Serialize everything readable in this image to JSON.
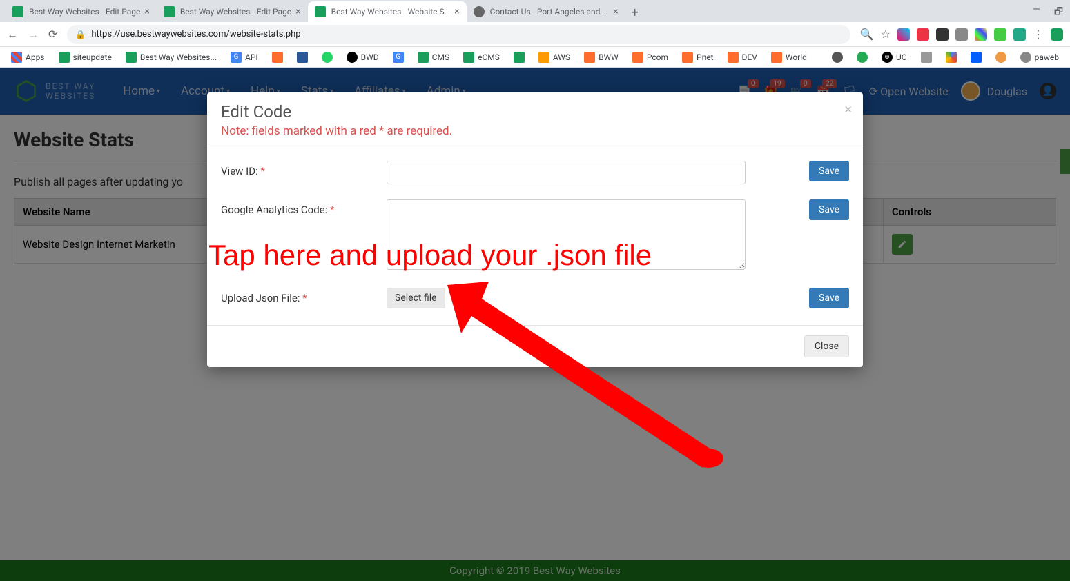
{
  "browser": {
    "tabs": [
      {
        "title": "Best Way Websites - Edit Page",
        "active": false
      },
      {
        "title": "Best Way Websites - Edit Page",
        "active": false
      },
      {
        "title": "Best Way Websites - Website Stat",
        "active": true
      },
      {
        "title": "Contact Us - Port Angeles and Se",
        "active": false
      }
    ],
    "url": "https://use.bestwaywebsites.com/website-stats.php",
    "bookmarks": [
      {
        "label": "Apps"
      },
      {
        "label": "siteupdate"
      },
      {
        "label": "Best Way Websites..."
      },
      {
        "label": "API"
      },
      {
        "label": ""
      },
      {
        "label": ""
      },
      {
        "label": ""
      },
      {
        "label": "BWD"
      },
      {
        "label": ""
      },
      {
        "label": "CMS"
      },
      {
        "label": "eCMS"
      },
      {
        "label": ""
      },
      {
        "label": "AWS"
      },
      {
        "label": "BWW"
      },
      {
        "label": "Pcom"
      },
      {
        "label": "Pnet"
      },
      {
        "label": "DEV"
      },
      {
        "label": "World"
      },
      {
        "label": ""
      },
      {
        "label": ""
      },
      {
        "label": "UC"
      },
      {
        "label": ""
      },
      {
        "label": ""
      },
      {
        "label": ""
      },
      {
        "label": ""
      },
      {
        "label": "paweb"
      }
    ]
  },
  "app": {
    "logo_top": "BEST WAY",
    "logo_bottom": "WEBSITES",
    "nav": [
      "Home",
      "Account",
      "Help",
      "Stats",
      "Affiliates",
      "Admin"
    ],
    "badges": {
      "first": "0",
      "second": "19",
      "third": "0",
      "fourth": "22"
    },
    "open_website": "Open Website",
    "user_name": "Douglas"
  },
  "page": {
    "title": "Website Stats",
    "note": "Publish all pages after updating yo",
    "col_name": "Website Name",
    "col_controls": "Controls",
    "row_name": "Website Design Internet Marketin"
  },
  "modal": {
    "title": "Edit Code",
    "note": "Note: fields marked with a red * are required.",
    "label_view_id": "View ID: ",
    "label_ga": "Google Analytics Code: ",
    "label_json": "Upload Json File: ",
    "select_file": "Select file",
    "save": "Save",
    "close": "Close"
  },
  "annotation": {
    "text": "Tap here and upload your .json file"
  },
  "footer": "Copyright © 2019  Best Way Websites"
}
